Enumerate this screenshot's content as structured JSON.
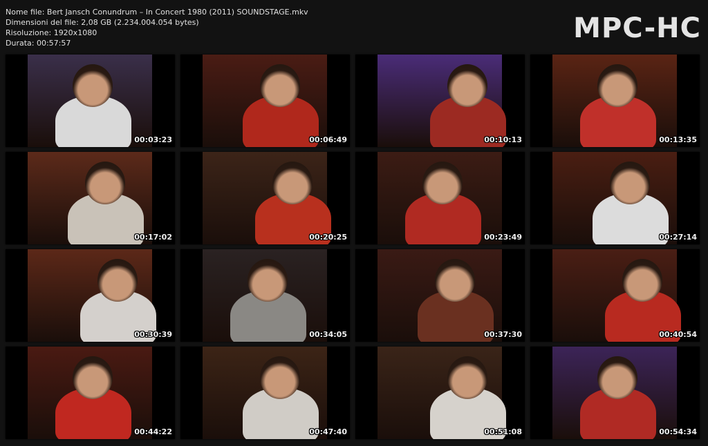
{
  "info": {
    "file_name": "Nome file: Bert Jansch Conundrum – In Concert 1980 (2011) SOUNDSTAGE.mkv",
    "file_size": "Dimensioni del file: 2,08 GB (2.234.004.054 bytes)",
    "resolution": "Risoluzione: 1920x1080",
    "duration": "Durata: 00:57:57"
  },
  "logo": "MPC-HC",
  "thumbnails": [
    {
      "time": "00:03:23",
      "bg": "#3a2f4a",
      "fig": "#d9d9d9"
    },
    {
      "time": "00:06:49",
      "bg": "#4a1c14",
      "fig": "#b0281c"
    },
    {
      "time": "00:10:13",
      "bg": "#4a2c78",
      "fig": "#9c2a22"
    },
    {
      "time": "00:13:35",
      "bg": "#5a2414",
      "fig": "#c0302a"
    },
    {
      "time": "00:17:02",
      "bg": "#5c2a1a",
      "fig": "#c9c2b8"
    },
    {
      "time": "00:20:25",
      "bg": "#3c2418",
      "fig": "#b8301e"
    },
    {
      "time": "00:23:49",
      "bg": "#3c1c14",
      "fig": "#b02a22"
    },
    {
      "time": "00:27:14",
      "bg": "#4a1e12",
      "fig": "#dcdcdc"
    },
    {
      "time": "00:30:39",
      "bg": "#5c2818",
      "fig": "#d4d0cc"
    },
    {
      "time": "00:34:05",
      "bg": "#2a2222",
      "fig": "#8a8884"
    },
    {
      "time": "00:37:30",
      "bg": "#3a1a14",
      "fig": "#6a3020"
    },
    {
      "time": "00:40:54",
      "bg": "#4a1e14",
      "fig": "#b82a20"
    },
    {
      "time": "00:44:22",
      "bg": "#4a1a12",
      "fig": "#c02820"
    },
    {
      "time": "00:47:40",
      "bg": "#3c2416",
      "fig": "#d0ccc6"
    },
    {
      "time": "00:51:08",
      "bg": "#3a2418",
      "fig": "#d6d2cc"
    },
    {
      "time": "00:54:34",
      "bg": "#3c2458",
      "fig": "#b02a24"
    }
  ]
}
